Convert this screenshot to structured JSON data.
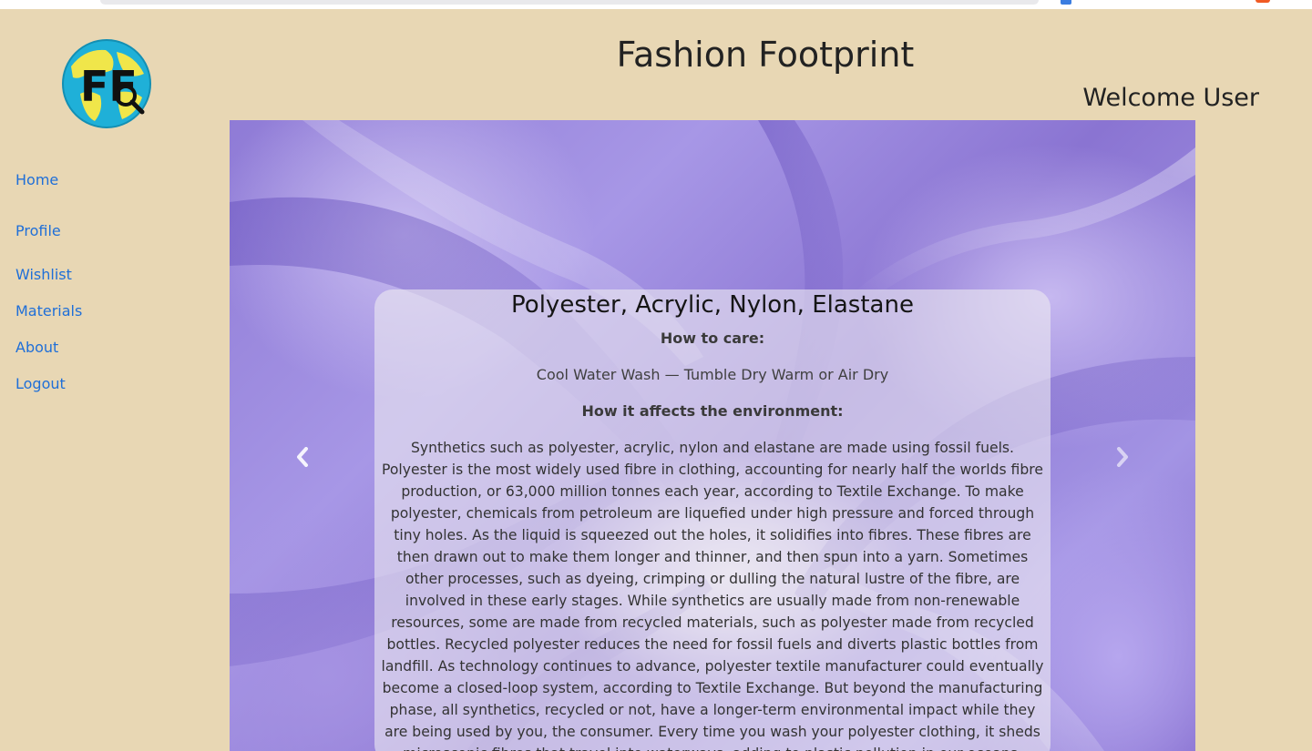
{
  "app": {
    "title": "Fashion Footprint",
    "welcome": "Welcome User",
    "logo_text": "FF"
  },
  "nav": {
    "items": [
      {
        "label": "Home"
      },
      {
        "label": "Profile"
      },
      {
        "label": "Wishlist"
      },
      {
        "label": "Materials"
      },
      {
        "label": "About"
      },
      {
        "label": "Logout"
      }
    ]
  },
  "carousel": {
    "prev_icon": "chevron-left-icon",
    "next_icon": "chevron-right-icon",
    "slide": {
      "heading": "Polyester, Acrylic, Nylon, Elastane",
      "care_heading": "How to care:",
      "care_text": "Cool Water Wash — Tumble Dry Warm or Air Dry",
      "env_heading": "How it affects the environment:",
      "env_text": "Synthetics such as polyester, acrylic, nylon and elastane are made using fossil fuels. Polyester is the most widely used fibre in clothing, accounting for nearly half the worlds fibre production, or 63,000 million tonnes each year, according to Textile Exchange. To make polyester, chemicals from petroleum are liquefied under high pressure and forced through tiny holes. As the liquid is squeezed out the holes, it solidifies into fibres. These fibres are then drawn out to make them longer and thinner, and then spun into a yarn. Sometimes other processes, such as dyeing, crimping or dulling the natural lustre of the fibre, are involved in these early stages. While synthetics are usually made from non-renewable resources, some are made from recycled materials, such as polyester made from recycled bottles. Recycled polyester reduces the need for fossil fuels and diverts plastic bottles from landfill. As technology continues to advance, polyester textile manufacturer could eventually become a closed-loop system, according to Textile Exchange. But beyond the manufacturing phase, all synthetics, recycled or not, have a longer-term environmental impact while they are being used by you, the consumer. Every time you wash your polyester clothing, it sheds microscopic fibres that travel into waterways, adding to plastic pollution in our oceans."
    }
  },
  "colors": {
    "page_bg": "#e8d7b4",
    "link": "#1f6fd8",
    "fabric": "#8f7bd6"
  }
}
